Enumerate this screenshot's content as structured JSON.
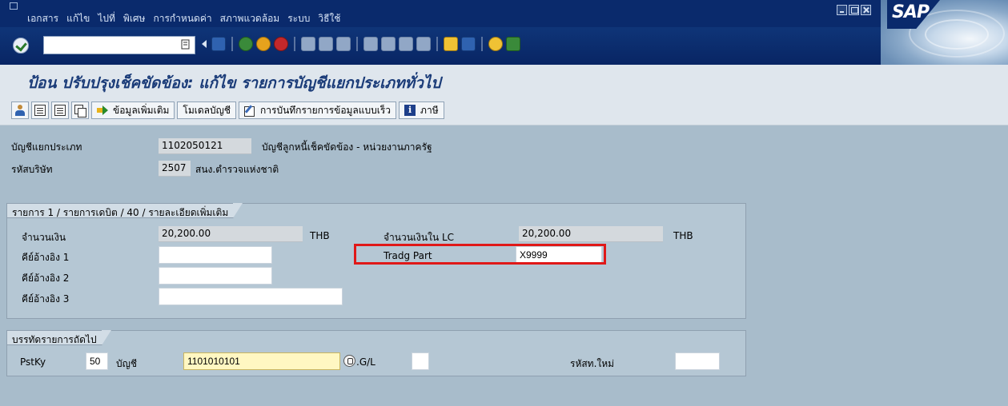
{
  "menu": [
    "เอกสาร",
    "แก้ไข",
    "ไปที่",
    "พิเศษ",
    "การกำหนดค่า",
    "สภาพแวดล้อม",
    "ระบบ",
    "วิธีใช้"
  ],
  "logo_text": "SAP",
  "command_field": {
    "value": ""
  },
  "screen_title": "ป้อน ปรับปรุงเช็คขัดข้อง: แก้ไข รายการบัญชีแยกประเภททั่วไป",
  "app_toolbar": {
    "additional_data": "ข้อมูลเพิ่มเติม",
    "account_model": "โมเดลบัญชี",
    "fast_data_entry": "การบันทึกรายการข้อมูลแบบเร็ว",
    "taxes": "ภาษี"
  },
  "header": {
    "gl_account_label": "บัญชีแยกประเภท",
    "gl_account_value": "1102050121",
    "gl_account_text": "บัญชีลูกหนี้เช็คขัดข้อง - หน่วยงานภาครัฐ",
    "company_code_label": "รหัสบริษัท",
    "company_code_value": "2507",
    "company_code_text": "สนง.ตำรวจแห่งชาติ"
  },
  "item_group": {
    "title": "รายการ 1 / รายการเดบิต / 40 / รายละเอียดเพิ่มเติม",
    "amount_label": "จำนวนเงิน",
    "amount_value": "20,200.00",
    "amount_currency": "THB",
    "amount_lc_label": "จำนวนเงินใน LC",
    "amount_lc_value": "20,200.00",
    "amount_lc_currency": "THB",
    "ref_key1_label": "คีย์อ้างอิง 1",
    "ref_key1_value": "",
    "ref_key2_label": "คีย์อ้างอิง 2",
    "ref_key2_value": "",
    "ref_key3_label": "คีย์อ้างอิง 3",
    "ref_key3_value": "",
    "trading_partner_label": "Tradg Part",
    "trading_partner_value": "X9999"
  },
  "next_line": {
    "title": "บรรทัดรายการถัดไป",
    "pstky_label": "PstKy",
    "pstky_value": "50",
    "account_label": "บัญชี",
    "account_value": "1101010101",
    "sgl_label": ".G/L",
    "sgl_value": "",
    "new_cocode_label": "รหัสท.ใหม่",
    "new_cocode_value": ""
  }
}
